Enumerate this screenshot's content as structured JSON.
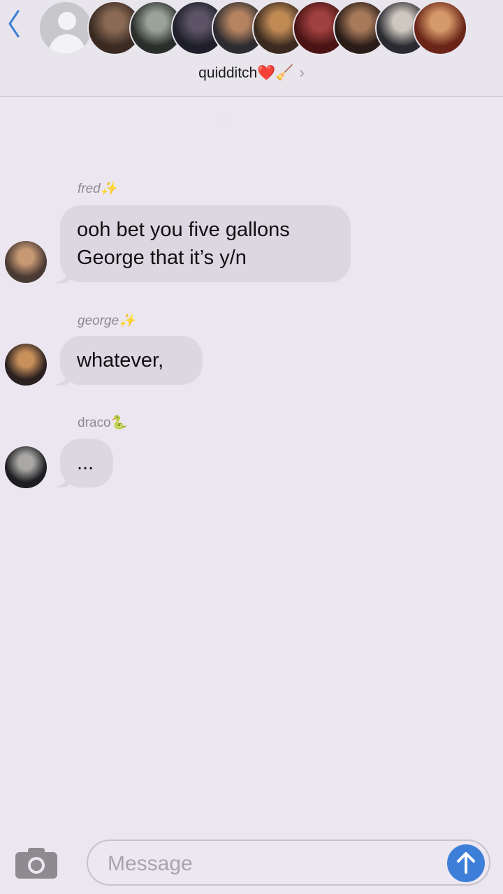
{
  "header": {
    "group_name": "quidditch❤️🧹",
    "chevron": "›",
    "participants": [
      {
        "name": "default-contact",
        "colors": [
          "#c8c7cc",
          "#c8c7cc"
        ]
      },
      {
        "name": "participant-1",
        "colors": [
          "#3a2a22",
          "#8a6a55"
        ]
      },
      {
        "name": "participant-2",
        "colors": [
          "#2a2e2a",
          "#9aa39a"
        ]
      },
      {
        "name": "participant-3",
        "colors": [
          "#1e1f2a",
          "#5c5466"
        ]
      },
      {
        "name": "participant-4",
        "colors": [
          "#2d2c30",
          "#b58360"
        ]
      },
      {
        "name": "participant-5",
        "colors": [
          "#3a2a20",
          "#c08a55"
        ]
      },
      {
        "name": "participant-6",
        "colors": [
          "#4a1414",
          "#a04040"
        ]
      },
      {
        "name": "participant-7",
        "colors": [
          "#2a1c18",
          "#a87a5a"
        ]
      },
      {
        "name": "participant-8",
        "colors": [
          "#2a2a30",
          "#cfc8c0"
        ]
      },
      {
        "name": "participant-9",
        "colors": [
          "#6a2418",
          "#d69a6a"
        ]
      }
    ]
  },
  "messages": [
    {
      "sender": "fred✨",
      "text_lines": [
        "ooh bet you five gallons",
        "George that it’s y/n"
      ],
      "avatar_colors": [
        "#4a3a34",
        "#c89a74"
      ]
    },
    {
      "sender": "george✨",
      "text_lines": [
        "whatever,"
      ],
      "avatar_colors": [
        "#2a2020",
        "#c8905a"
      ]
    },
    {
      "sender": "draco🐍",
      "text_lines": [
        "..."
      ],
      "avatar_colors": [
        "#1e1e22",
        "#a9a8a5"
      ]
    }
  ],
  "composer": {
    "placeholder": "Message"
  },
  "colors": {
    "background": "#ebe6ef",
    "bubble": "#dcd7e1",
    "send_button": "#3d7fd8",
    "back_chevron": "#3d7fd8"
  }
}
